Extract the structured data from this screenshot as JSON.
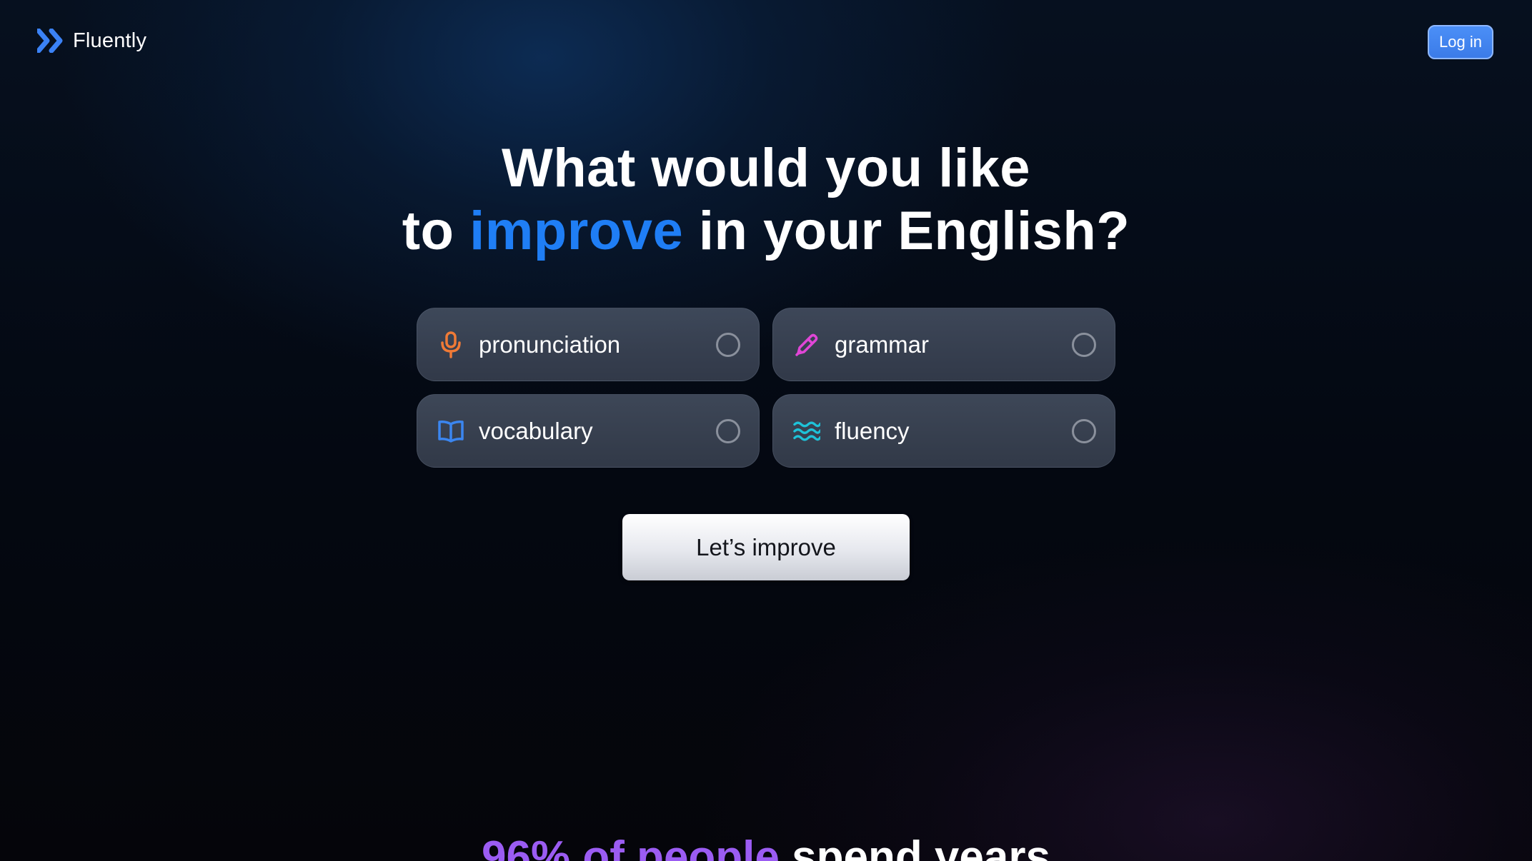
{
  "header": {
    "brand": "Fluently",
    "login_label": "Log in"
  },
  "hero": {
    "line1": "What would you like",
    "line2_pre": "to ",
    "line2_accent": "improve",
    "line2_post": " in your English?"
  },
  "options": [
    {
      "label": "pronunciation",
      "icon": "microphone-icon",
      "icon_color": "#f07a36"
    },
    {
      "label": "grammar",
      "icon": "pen-icon",
      "icon_color": "#e046d6"
    },
    {
      "label": "vocabulary",
      "icon": "open-book-icon",
      "icon_color": "#3b86f0"
    },
    {
      "label": "fluency",
      "icon": "waves-icon",
      "icon_color": "#1ec2d8"
    }
  ],
  "cta": {
    "label": "Let’s improve"
  },
  "teaser": {
    "accent": "96% of people",
    "rest": " spend years"
  },
  "colors": {
    "accent_blue": "#1f7ef5",
    "accent_purple": "#9b5cf2",
    "login_bg": "#3b7be8"
  }
}
